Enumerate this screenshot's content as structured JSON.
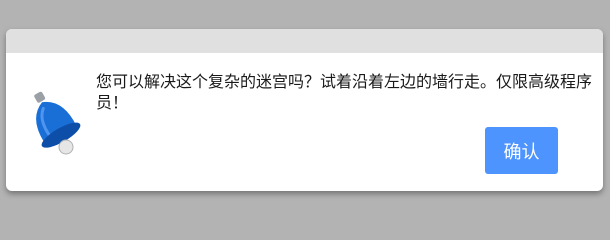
{
  "dialog": {
    "icon": "bell-icon",
    "message": "您可以解决这个复杂的迷宫吗？试着沿着左边的墙行走。仅限高级程序员！",
    "confirm_label": "确认"
  },
  "colors": {
    "background": "#b3b3b3",
    "titlebar": "#e0e0e0",
    "dialog": "#ffffff",
    "button": "#4d94ff",
    "bell": "#1a6fd6"
  }
}
